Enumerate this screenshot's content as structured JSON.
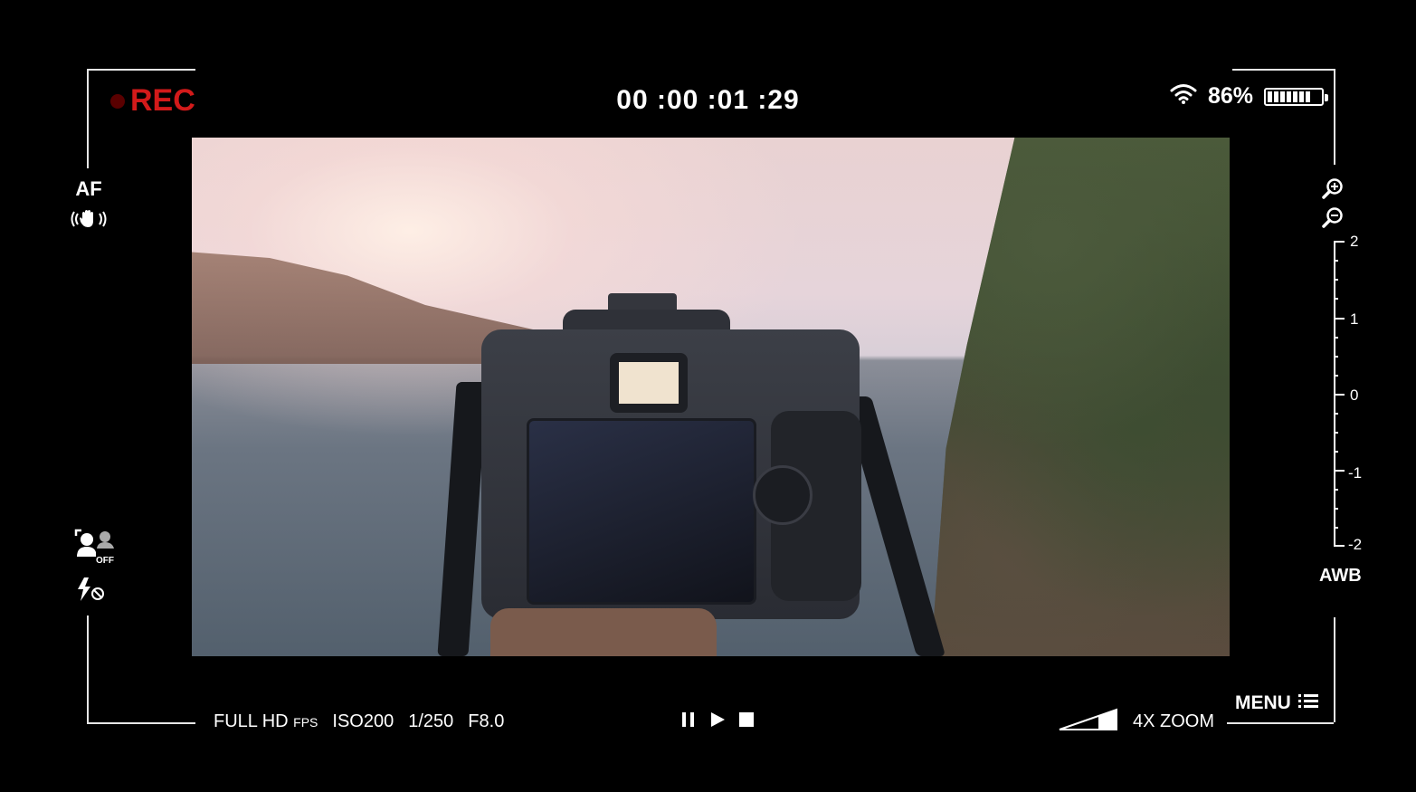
{
  "recording": {
    "label": "REC",
    "color": "#d21a1a"
  },
  "timecode": "00 :00 :01 :29",
  "status": {
    "battery_percent": "86%",
    "battery_level": 0.86,
    "wifi_icon": "wifi-icon"
  },
  "left_panel": {
    "af_label": "AF",
    "af_mode_icon": "hand-stabilizer-icon",
    "face_detect_icon": "face-detect-off-icon",
    "flash_icon": "flash-off-icon"
  },
  "right_panel": {
    "zoom_in_icon": "zoom-in-icon",
    "zoom_out_icon": "zoom-out-icon",
    "ev_scale": [
      "2",
      "1",
      "0",
      "-1",
      "-2"
    ],
    "awb_label": "AWB"
  },
  "bottom": {
    "resolution": "FULL HD",
    "fps_label": "FPS",
    "iso": "ISO200",
    "shutter": "1/250",
    "aperture": "F8.0",
    "zoom": "4X ZOOM",
    "menu_label": "MENU",
    "transport": [
      "pause-icon",
      "play-icon",
      "stop-icon"
    ]
  }
}
